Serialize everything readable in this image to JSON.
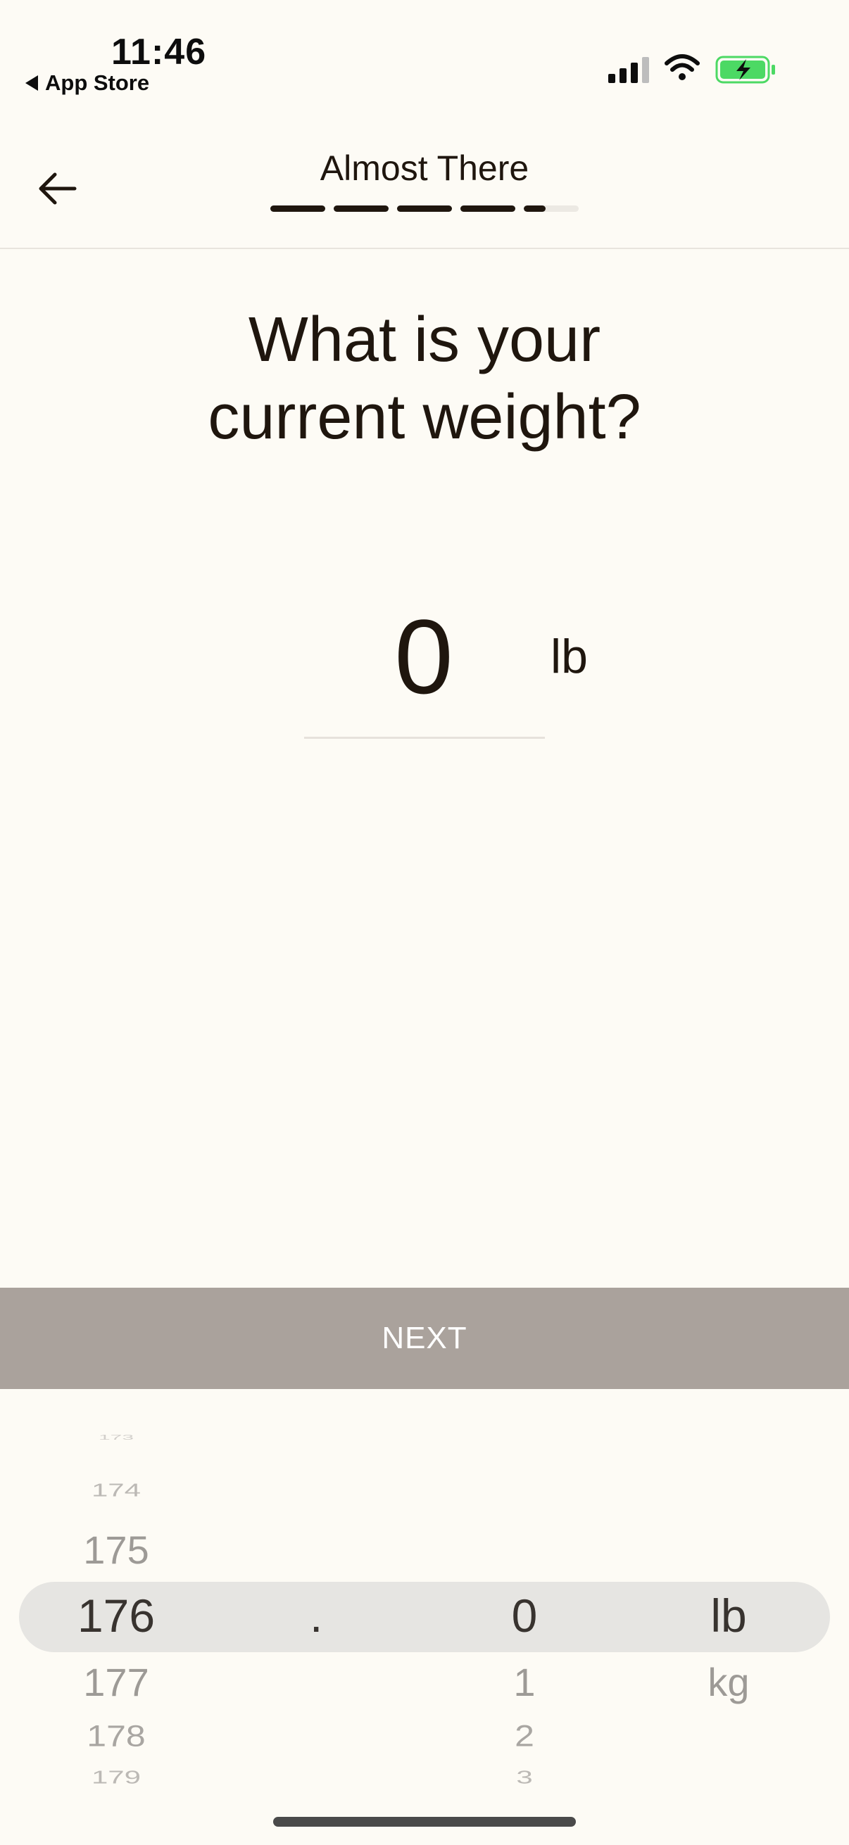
{
  "status_bar": {
    "time": "11:46",
    "back_app": "App Store",
    "battery_color": "#4cd964"
  },
  "header": {
    "title": "Almost There",
    "progress": 0.88,
    "progress_segments": 5
  },
  "question": {
    "line1": "What is your",
    "line2": "current weight?"
  },
  "weight": {
    "value": "0",
    "unit": "lb"
  },
  "next_button": {
    "label": "NEXT",
    "color": "#aaa29c"
  },
  "picker": {
    "integer": {
      "above": [
        "173",
        "174",
        "175"
      ],
      "selected": "176",
      "below": [
        "177",
        "178",
        "179"
      ]
    },
    "separator": ".",
    "decimal": {
      "selected": "0",
      "below": [
        "1",
        "2",
        "3"
      ]
    },
    "unit": {
      "selected": "lb",
      "below": [
        "kg"
      ]
    }
  },
  "colors": {
    "background": "#fdfbf5",
    "text": "#1f160e",
    "picker_highlight": "#e6e5e2"
  }
}
